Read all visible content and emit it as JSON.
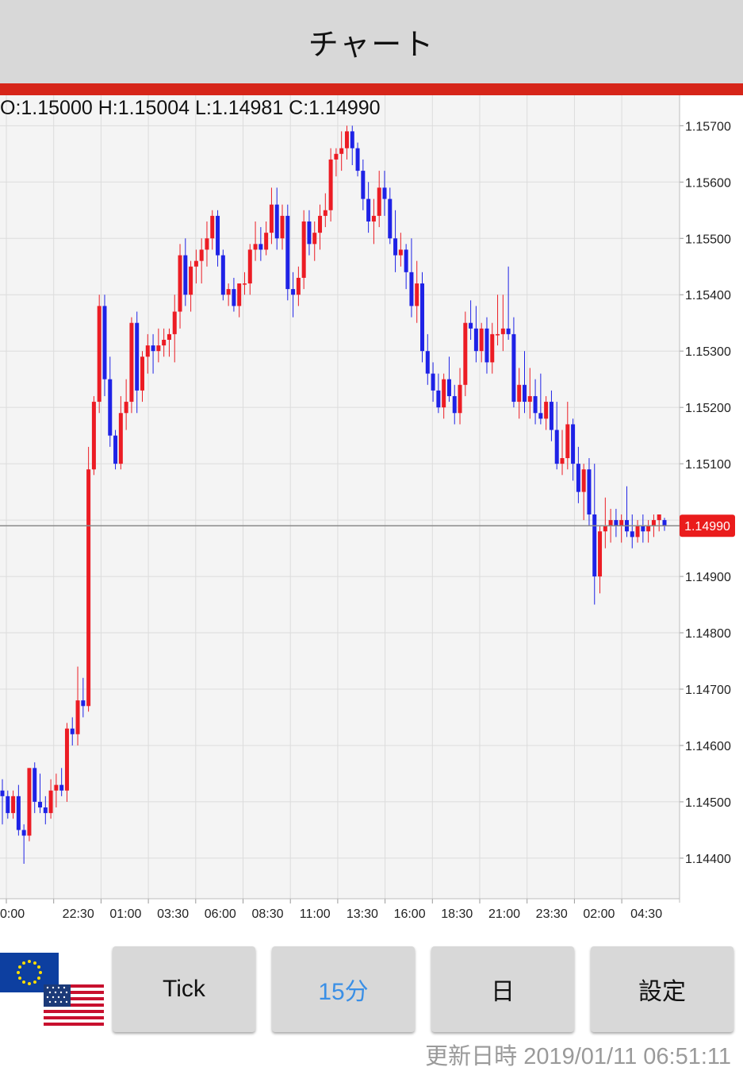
{
  "header": {
    "title": "チャート"
  },
  "ohlc": {
    "text": "O:1.15000 H:1.15004 L:1.14981 C:1.14990"
  },
  "colors": {
    "up": "#ec1c24",
    "down": "#1e22e6",
    "accent": "#d62519",
    "price_tag": "#ea1c1c"
  },
  "chart_data": {
    "type": "candlestick",
    "yticks": [
      "1.15700",
      "1.15600",
      "1.15500",
      "1.15400",
      "1.15300",
      "1.15200",
      "1.15100",
      "1.15000",
      "1.14900",
      "1.14800",
      "1.14700",
      "1.14600",
      "1.14500",
      "1.14400"
    ],
    "xticks": [
      "0:00",
      "22:30",
      "01:00",
      "03:30",
      "06:00",
      "08:30",
      "11:00",
      "13:30",
      "16:00",
      "18:30",
      "21:00",
      "23:30",
      "02:00",
      "04:30"
    ],
    "ylim": [
      1.14328,
      1.15754
    ],
    "current_price": "1.14990",
    "grid": true,
    "candles": [
      [
        1.1452,
        1.1454,
        1.1446,
        1.1451
      ],
      [
        1.1451,
        1.1452,
        1.1447,
        1.1448
      ],
      [
        1.1448,
        1.1452,
        1.1447,
        1.1451
      ],
      [
        1.1451,
        1.1453,
        1.1444,
        1.1445
      ],
      [
        1.1445,
        1.1446,
        1.1439,
        1.1444
      ],
      [
        1.1444,
        1.1456,
        1.1443,
        1.1456
      ],
      [
        1.1456,
        1.1457,
        1.1448,
        1.145
      ],
      [
        1.145,
        1.1455,
        1.1448,
        1.1449
      ],
      [
        1.1449,
        1.1451,
        1.1446,
        1.1448
      ],
      [
        1.1448,
        1.1454,
        1.1447,
        1.1452
      ],
      [
        1.1452,
        1.1455,
        1.1449,
        1.1453
      ],
      [
        1.1453,
        1.1456,
        1.1451,
        1.1452
      ],
      [
        1.1452,
        1.1464,
        1.145,
        1.1463
      ],
      [
        1.1463,
        1.1465,
        1.146,
        1.1462
      ],
      [
        1.1462,
        1.1474,
        1.146,
        1.1468
      ],
      [
        1.1468,
        1.1472,
        1.1465,
        1.1467
      ],
      [
        1.1467,
        1.1513,
        1.1466,
        1.1509
      ],
      [
        1.1509,
        1.1522,
        1.1508,
        1.1521
      ],
      [
        1.1521,
        1.154,
        1.1519,
        1.1538
      ],
      [
        1.1538,
        1.154,
        1.1522,
        1.1525
      ],
      [
        1.1525,
        1.1529,
        1.1513,
        1.1515
      ],
      [
        1.1515,
        1.1516,
        1.1509,
        1.151
      ],
      [
        1.151,
        1.1522,
        1.1509,
        1.1519
      ],
      [
        1.1519,
        1.1525,
        1.1516,
        1.1521
      ],
      [
        1.1521,
        1.1536,
        1.1519,
        1.1535
      ],
      [
        1.1535,
        1.1537,
        1.1519,
        1.1523
      ],
      [
        1.1523,
        1.153,
        1.1521,
        1.1529
      ],
      [
        1.1529,
        1.1533,
        1.1526,
        1.1531
      ],
      [
        1.1531,
        1.1533,
        1.1526,
        1.153
      ],
      [
        1.153,
        1.1534,
        1.1528,
        1.1531
      ],
      [
        1.1531,
        1.1534,
        1.1529,
        1.1532
      ],
      [
        1.1532,
        1.1534,
        1.1529,
        1.1533
      ],
      [
        1.1533,
        1.154,
        1.1528,
        1.1537
      ],
      [
        1.1537,
        1.1549,
        1.1534,
        1.1547
      ],
      [
        1.1547,
        1.155,
        1.1538,
        1.154
      ],
      [
        1.154,
        1.1546,
        1.1537,
        1.1545
      ],
      [
        1.1545,
        1.1548,
        1.1542,
        1.1546
      ],
      [
        1.1546,
        1.155,
        1.1542,
        1.1548
      ],
      [
        1.1548,
        1.1553,
        1.1545,
        1.155
      ],
      [
        1.155,
        1.1555,
        1.1548,
        1.1554
      ],
      [
        1.1554,
        1.1555,
        1.1545,
        1.1547
      ],
      [
        1.1547,
        1.1548,
        1.1539,
        1.154
      ],
      [
        1.154,
        1.1542,
        1.1538,
        1.1541
      ],
      [
        1.1541,
        1.1543,
        1.1537,
        1.1538
      ],
      [
        1.1538,
        1.1542,
        1.1536,
        1.1542
      ],
      [
        1.1542,
        1.1544,
        1.154,
        1.1542
      ],
      [
        1.1542,
        1.1549,
        1.154,
        1.1548
      ],
      [
        1.1548,
        1.1553,
        1.1546,
        1.1549
      ],
      [
        1.1549,
        1.1552,
        1.1546,
        1.1548
      ],
      [
        1.1548,
        1.1553,
        1.1547,
        1.1551
      ],
      [
        1.1551,
        1.1559,
        1.1549,
        1.1556
      ],
      [
        1.1556,
        1.1559,
        1.1548,
        1.155
      ],
      [
        1.155,
        1.1556,
        1.1548,
        1.1554
      ],
      [
        1.1554,
        1.1556,
        1.1539,
        1.1541
      ],
      [
        1.1541,
        1.1544,
        1.1536,
        1.154
      ],
      [
        1.154,
        1.1545,
        1.1538,
        1.1543
      ],
      [
        1.1543,
        1.1555,
        1.1541,
        1.1553
      ],
      [
        1.1553,
        1.1555,
        1.1547,
        1.1549
      ],
      [
        1.1549,
        1.1553,
        1.1546,
        1.1551
      ],
      [
        1.1551,
        1.1556,
        1.1548,
        1.1554
      ],
      [
        1.1554,
        1.1558,
        1.1552,
        1.1555
      ],
      [
        1.1555,
        1.1566,
        1.1553,
        1.1564
      ],
      [
        1.1564,
        1.1566,
        1.1561,
        1.1565
      ],
      [
        1.1565,
        1.1569,
        1.1562,
        1.1566
      ],
      [
        1.1566,
        1.157,
        1.1564,
        1.1569
      ],
      [
        1.1569,
        1.157,
        1.1563,
        1.1566
      ],
      [
        1.1566,
        1.1567,
        1.1561,
        1.1562
      ],
      [
        1.1562,
        1.1564,
        1.1555,
        1.1557
      ],
      [
        1.1557,
        1.156,
        1.1551,
        1.1553
      ],
      [
        1.1553,
        1.1557,
        1.1549,
        1.1554
      ],
      [
        1.1554,
        1.1562,
        1.1552,
        1.1559
      ],
      [
        1.1559,
        1.1562,
        1.1554,
        1.1557
      ],
      [
        1.1557,
        1.1559,
        1.1549,
        1.155
      ],
      [
        1.155,
        1.1555,
        1.1544,
        1.1547
      ],
      [
        1.1547,
        1.1551,
        1.1545,
        1.1548
      ],
      [
        1.1548,
        1.1549,
        1.1541,
        1.1544
      ],
      [
        1.1544,
        1.155,
        1.1536,
        1.1538
      ],
      [
        1.1538,
        1.1546,
        1.1535,
        1.1542
      ],
      [
        1.1542,
        1.1544,
        1.1528,
        1.153
      ],
      [
        1.153,
        1.1533,
        1.1524,
        1.1526
      ],
      [
        1.1526,
        1.1528,
        1.1521,
        1.1523
      ],
      [
        1.1523,
        1.1526,
        1.1519,
        1.152
      ],
      [
        1.152,
        1.1526,
        1.1518,
        1.1525
      ],
      [
        1.1525,
        1.1529,
        1.1521,
        1.1522
      ],
      [
        1.1522,
        1.1524,
        1.1517,
        1.1519
      ],
      [
        1.1519,
        1.1527,
        1.1517,
        1.1524
      ],
      [
        1.1524,
        1.1537,
        1.1522,
        1.1535
      ],
      [
        1.1535,
        1.1539,
        1.1532,
        1.1534
      ],
      [
        1.1534,
        1.1538,
        1.1528,
        1.153
      ],
      [
        1.153,
        1.1535,
        1.1528,
        1.1534
      ],
      [
        1.1534,
        1.1536,
        1.1526,
        1.1528
      ],
      [
        1.1528,
        1.1535,
        1.1526,
        1.1533
      ],
      [
        1.1533,
        1.154,
        1.1531,
        1.1533
      ],
      [
        1.1533,
        1.154,
        1.153,
        1.1534
      ],
      [
        1.1534,
        1.1545,
        1.1532,
        1.1533
      ],
      [
        1.1533,
        1.1536,
        1.152,
        1.1521
      ],
      [
        1.1521,
        1.1527,
        1.1518,
        1.1524
      ],
      [
        1.1524,
        1.153,
        1.1519,
        1.1521
      ],
      [
        1.1521,
        1.1527,
        1.1518,
        1.1522
      ],
      [
        1.1522,
        1.1525,
        1.1517,
        1.1519
      ],
      [
        1.1519,
        1.1526,
        1.1517,
        1.1518
      ],
      [
        1.1518,
        1.1522,
        1.1516,
        1.1521
      ],
      [
        1.1521,
        1.1523,
        1.1514,
        1.1516
      ],
      [
        1.1516,
        1.1521,
        1.1509,
        1.151
      ],
      [
        1.151,
        1.1516,
        1.1508,
        1.1511
      ],
      [
        1.1511,
        1.1521,
        1.1509,
        1.1517
      ],
      [
        1.1517,
        1.1518,
        1.1507,
        1.151
      ],
      [
        1.151,
        1.1513,
        1.1503,
        1.1505
      ],
      [
        1.1505,
        1.151,
        1.15,
        1.1509
      ],
      [
        1.1509,
        1.1511,
        1.1499,
        1.1501
      ],
      [
        1.1501,
        1.151,
        1.1485,
        1.149
      ],
      [
        1.149,
        1.1499,
        1.1487,
        1.1498
      ],
      [
        1.1498,
        1.1504,
        1.1495,
        1.1499
      ],
      [
        1.1499,
        1.1502,
        1.1496,
        1.15
      ],
      [
        1.15,
        1.1502,
        1.1497,
        1.1499
      ],
      [
        1.1499,
        1.1501,
        1.1496,
        1.15
      ],
      [
        1.15,
        1.1506,
        1.1497,
        1.1498
      ],
      [
        1.1498,
        1.1501,
        1.1495,
        1.1497
      ],
      [
        1.1497,
        1.15,
        1.1496,
        1.1499
      ],
      [
        1.1499,
        1.1501,
        1.1496,
        1.1498
      ],
      [
        1.1498,
        1.15,
        1.1496,
        1.1499
      ],
      [
        1.1499,
        1.1501,
        1.1497,
        1.15
      ],
      [
        1.15,
        1.1501,
        1.1498,
        1.1501
      ],
      [
        1.15,
        1.15004,
        1.14981,
        1.1499
      ]
    ]
  },
  "buttons": {
    "tick": "Tick",
    "m15": "15分",
    "day": "日",
    "settings": "設定"
  },
  "footer": {
    "updated_label": "更新日時",
    "updated_time": "2019/01/11 06:51:11"
  }
}
